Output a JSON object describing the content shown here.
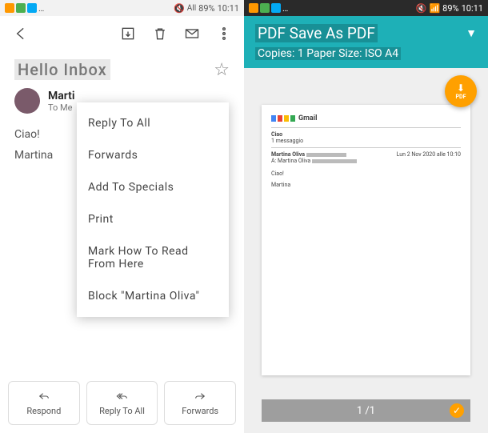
{
  "statusbar": {
    "battery_text": "89%",
    "time": "10:11",
    "signal": "All"
  },
  "left": {
    "subject": "Hello Inbox",
    "sender_name": "Marti",
    "sender_to": "To Me",
    "body_greeting": "Ciao!",
    "body_signature": "Martina",
    "menu": {
      "reply_all": "Reply To All",
      "forwards": "Forwards",
      "add_specials": "Add To Specials",
      "print": "Print",
      "mark_read": "Mark How To Read From Here",
      "block": "Block \"Martina Oliva\""
    },
    "actions": {
      "respond": "Respond",
      "reply_all": "Reply To All",
      "forwards": "Forwards"
    }
  },
  "right": {
    "header_title": "PDF Save As PDF",
    "header_sub": "Copies: 1 Paper Size: ISO A4",
    "fab_label": "PDF",
    "page_count": "1 /1",
    "preview": {
      "subject": "Ciao",
      "msg_count": "1 messaggio",
      "from": "Martina Oliva",
      "to_prefix": "A: Martina Oliva",
      "date": "Lun 2 Nov 2020 alle 10:10",
      "body1": "Ciao!",
      "body2": "Martina"
    }
  }
}
